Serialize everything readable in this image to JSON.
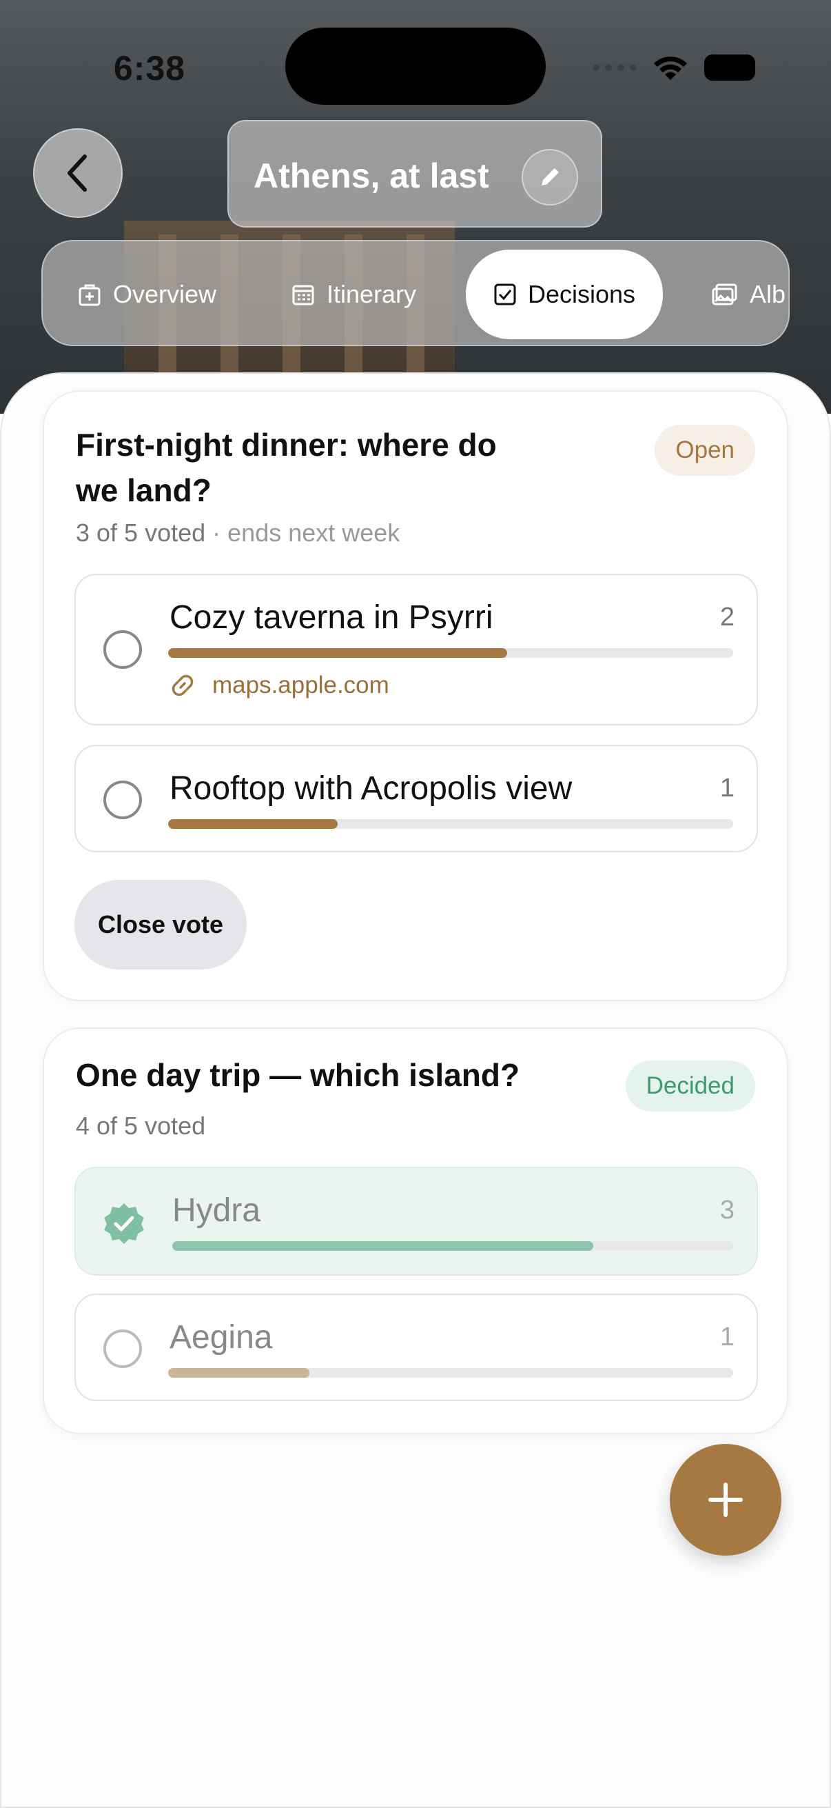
{
  "status_bar": {
    "time": "6:38"
  },
  "header": {
    "title": "Athens, at last"
  },
  "tabs": [
    {
      "label": "Overview"
    },
    {
      "label": "Itinerary"
    },
    {
      "label": "Decisions"
    },
    {
      "label": "Alb"
    }
  ],
  "polls": [
    {
      "title_line1": "First-night dinner: where do",
      "title_line2": "we land?",
      "votes": "3 of 5 voted",
      "deadline": "· ends next week",
      "status": "Open",
      "options": [
        {
          "label": "Cozy taverna in Psyrri",
          "count": "2",
          "fraction": 0.6,
          "link": "maps.apple.com"
        },
        {
          "label": "Rooftop with Acropolis view",
          "count": "1",
          "fraction": 0.3
        }
      ],
      "action": "Close vote"
    },
    {
      "title": "One day trip — which island?",
      "votes": "4 of 5 voted",
      "status": "Decided",
      "options": [
        {
          "label": "Hydra",
          "count": "3",
          "fraction": 0.75,
          "winner": true
        },
        {
          "label": "Aegina",
          "count": "1",
          "fraction": 0.25
        }
      ]
    }
  ],
  "colors": {
    "accent": "#a67943",
    "bar_brown": "#a67943",
    "bar_green": "#8cc5ac",
    "bar_tan": "#c9b598",
    "winner_bg": "#eaf4f0",
    "decided_text": "#3e9a74"
  },
  "icons": {
    "back": "chevron-left-icon",
    "edit": "pencil-icon",
    "overview": "suitcase-icon",
    "itinerary": "calendar-icon",
    "decisions": "checkbox-icon",
    "album": "photos-icon",
    "link": "link-icon",
    "winner": "verified-check-icon",
    "fab": "plus-icon"
  }
}
